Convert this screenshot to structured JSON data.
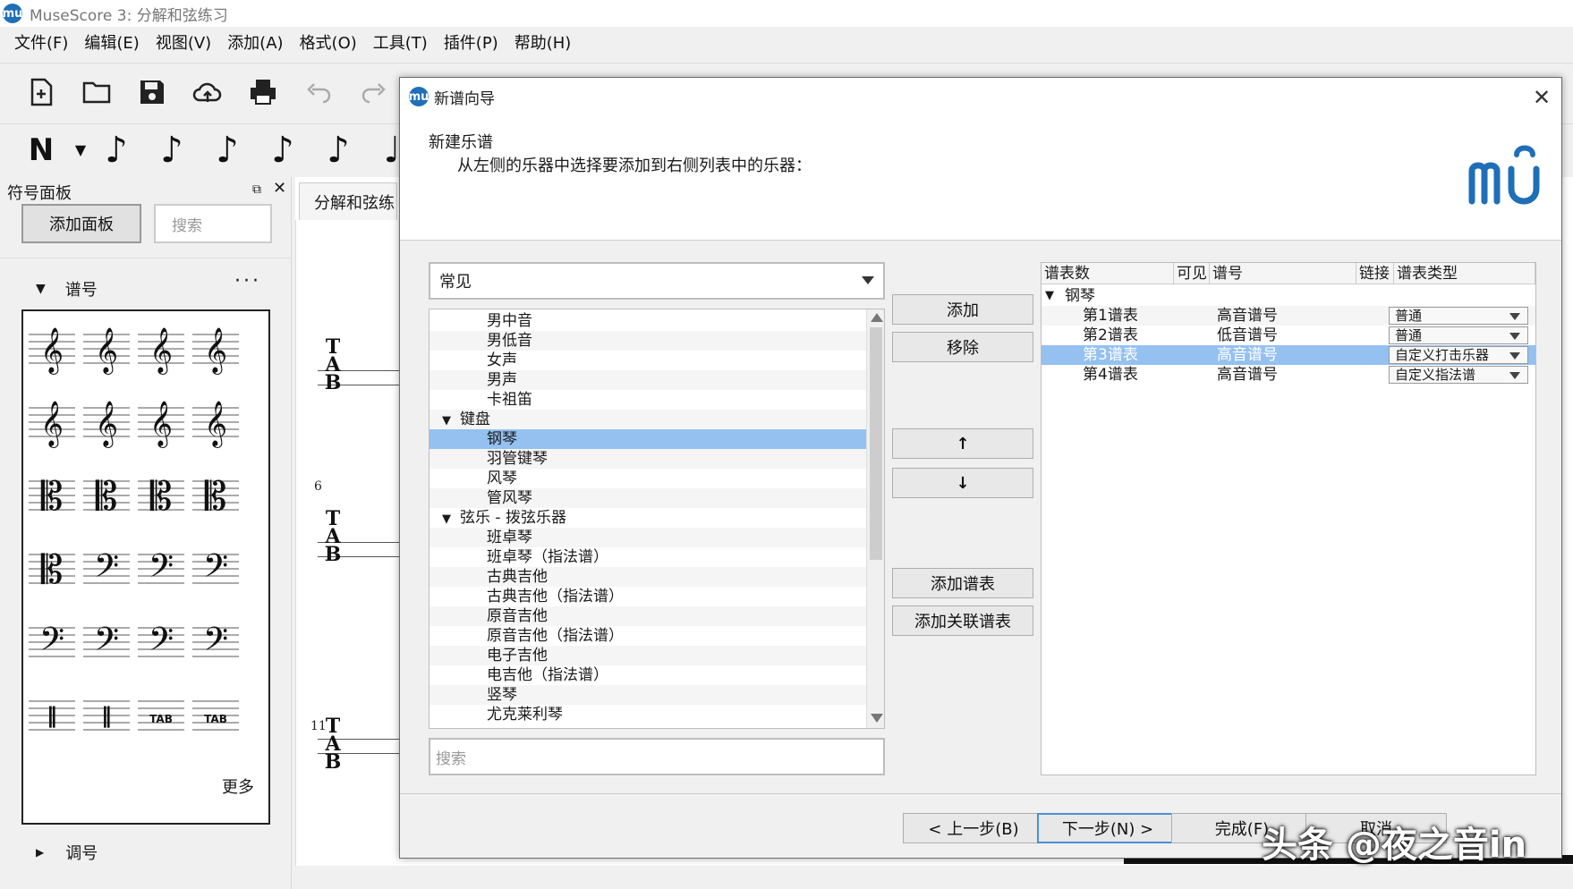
{
  "window": {
    "title": "MuseScore 3: 分解和弦练习",
    "logo": "mu"
  },
  "menu": [
    "文件(F)",
    "编辑(E)",
    "视图(V)",
    "添加(A)",
    "格式(O)",
    "工具(T)",
    "插件(P)",
    "帮助(H)"
  ],
  "palette": {
    "title": "符号面板",
    "add_button": "添加面板",
    "search_placeholder": "搜索",
    "section_clefs": "谱号",
    "more_dots": "···",
    "more": "更多",
    "section_keys": "调号"
  },
  "score": {
    "tab": "分解和弦练",
    "tab_clef": "T A B",
    "measure_numbers": [
      "6",
      "11"
    ]
  },
  "dialog": {
    "title": "新谱向导",
    "header_title": "新建乐谱",
    "header_subtitle": "从左侧的乐器中选择要添加到右侧列表中的乐器：",
    "family_select": "常见",
    "instruments": [
      {
        "label": "男中音",
        "type": "item"
      },
      {
        "label": "男低音",
        "type": "item"
      },
      {
        "label": "女声",
        "type": "item"
      },
      {
        "label": "男声",
        "type": "item"
      },
      {
        "label": "卡祖笛",
        "type": "item"
      },
      {
        "label": "键盘",
        "type": "group"
      },
      {
        "label": "钢琴",
        "type": "item",
        "selected": true
      },
      {
        "label": "羽管键琴",
        "type": "item"
      },
      {
        "label": "风琴",
        "type": "item"
      },
      {
        "label": "管风琴",
        "type": "item"
      },
      {
        "label": "弦乐 - 拨弦乐器",
        "type": "group"
      },
      {
        "label": "班卓琴",
        "type": "item"
      },
      {
        "label": "班卓琴（指法谱）",
        "type": "item"
      },
      {
        "label": "古典吉他",
        "type": "item"
      },
      {
        "label": "古典吉他（指法谱）",
        "type": "item"
      },
      {
        "label": "原音吉他",
        "type": "item"
      },
      {
        "label": "原音吉他（指法谱）",
        "type": "item"
      },
      {
        "label": "电子吉他",
        "type": "item"
      },
      {
        "label": "电吉他（指法谱）",
        "type": "item"
      },
      {
        "label": "竖琴",
        "type": "item"
      },
      {
        "label": "尤克莱利琴",
        "type": "item"
      }
    ],
    "search_placeholder": "搜索",
    "buttons": {
      "add": "添加",
      "remove": "移除",
      "up": "↑",
      "down": "↓",
      "add_staff": "添加谱表",
      "add_linked_staff": "添加关联谱表"
    },
    "staff_table": {
      "headers": [
        "谱表数",
        "可见",
        "谱号",
        "链接",
        "谱表类型"
      ],
      "instrument": "钢琴",
      "rows": [
        {
          "name": "第1谱表",
          "clef": "高音谱号",
          "type": "普通"
        },
        {
          "name": "第2谱表",
          "clef": "低音谱号",
          "type": "普通"
        },
        {
          "name": "第3谱表",
          "clef": "高音谱号",
          "type": "自定义打击乐器",
          "selected": true
        },
        {
          "name": "第4谱表",
          "clef": "高音谱号",
          "type": "自定义指法谱"
        }
      ]
    },
    "footer": {
      "back": "< 上一步(B)",
      "next": "下一步(N) >",
      "finish": "完成(F)",
      "cancel": "取消"
    }
  },
  "watermark": "头条 @夜之音in",
  "colors": {
    "selection": "#94c1f0",
    "brand_blue": "#1f6fb8"
  }
}
